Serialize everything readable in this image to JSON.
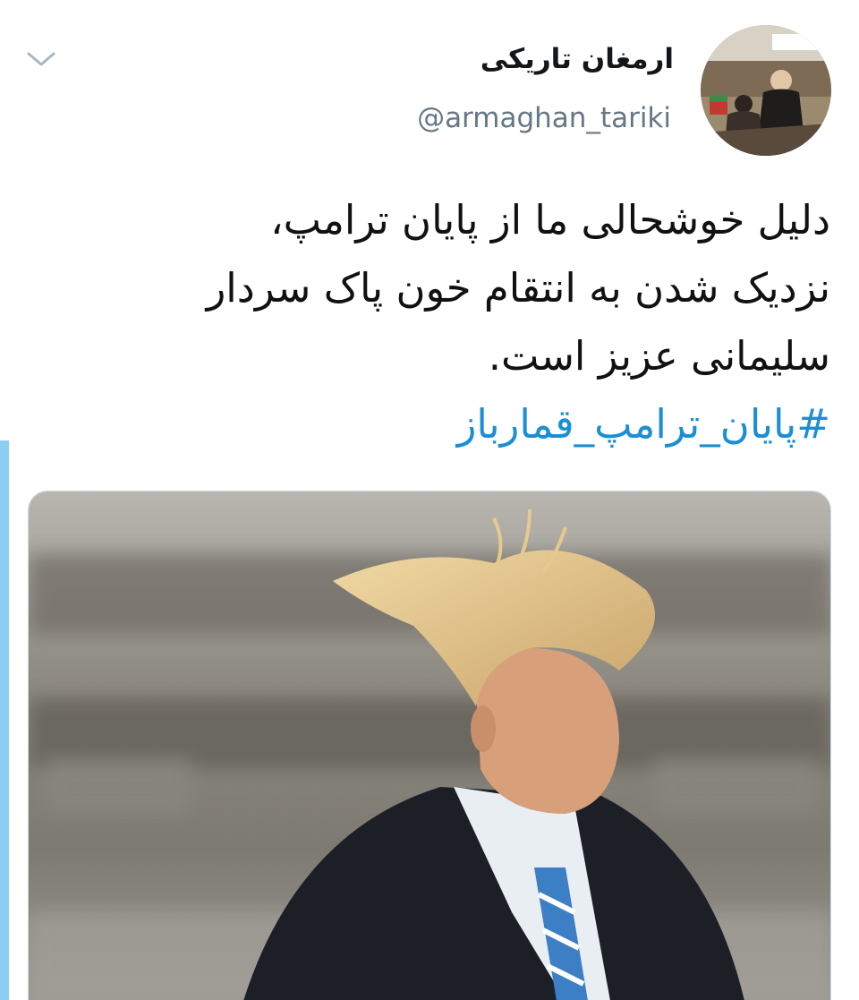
{
  "tweet": {
    "author": {
      "display_name": "ارمغان تاریکی",
      "handle": "@armaghan_tariki"
    },
    "body_lines": [
      "دلیل خوشحالی ما از پایان ترامپ،",
      "نزدیک شدن به انتقام خون پاک سردار",
      "سلیمانی عزیز است."
    ],
    "hashtag": "#پایان_ترامپ_قمارباز",
    "menu_icon": "chevron-down-icon"
  },
  "colors": {
    "hashtag": "#1b8fd6",
    "handle": "#657786",
    "accent_bar": "#8ccdf3"
  }
}
